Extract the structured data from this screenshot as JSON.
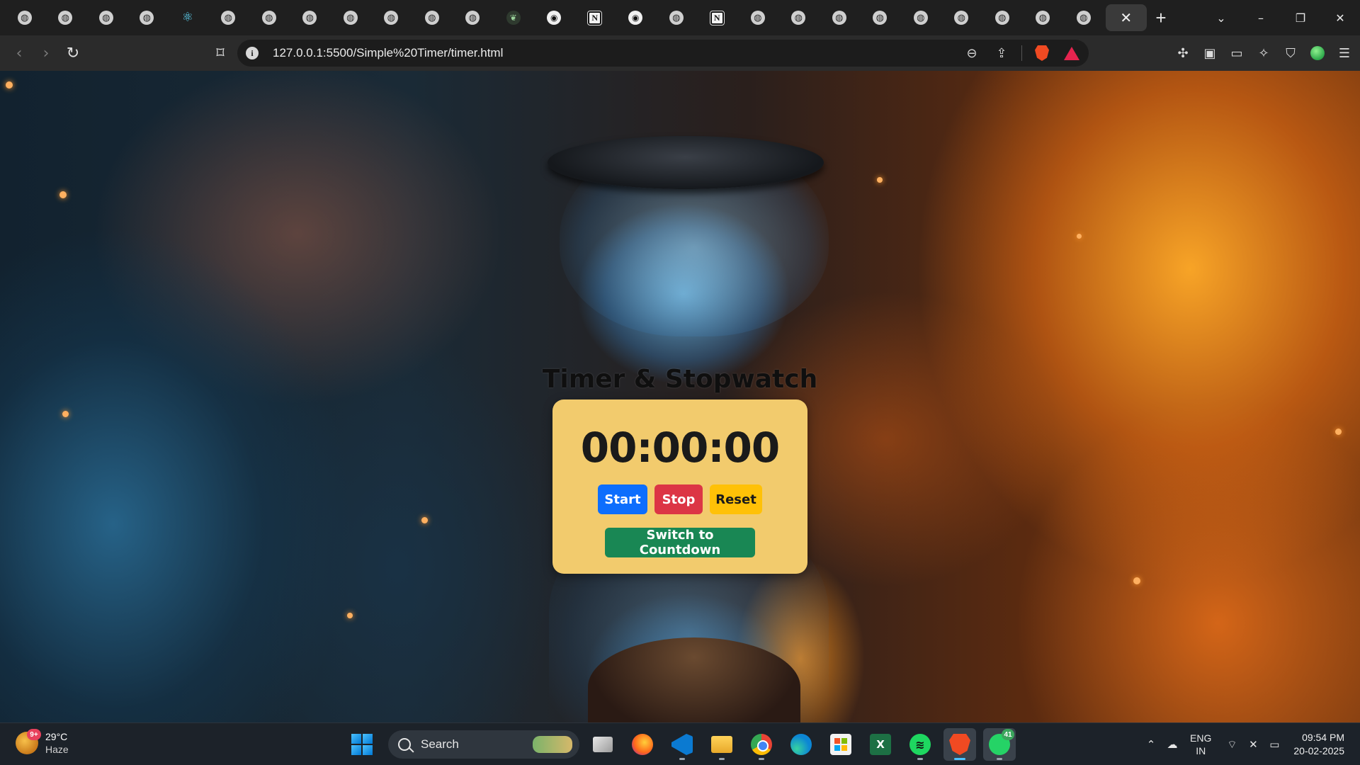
{
  "browser": {
    "tabs": [
      {
        "icon": "globe-icon"
      },
      {
        "icon": "globe-icon"
      },
      {
        "icon": "globe-icon"
      },
      {
        "icon": "globe-icon"
      },
      {
        "icon": "react-icon"
      },
      {
        "icon": "globe-icon"
      },
      {
        "icon": "globe-icon"
      },
      {
        "icon": "globe-icon"
      },
      {
        "icon": "globe-icon"
      },
      {
        "icon": "globe-icon"
      },
      {
        "icon": "globe-icon"
      },
      {
        "icon": "globe-icon"
      },
      {
        "icon": "leaf-icon"
      },
      {
        "icon": "github-icon"
      },
      {
        "icon": "notion-icon"
      },
      {
        "icon": "github-icon"
      },
      {
        "icon": "globe-icon"
      },
      {
        "icon": "notion-icon"
      },
      {
        "icon": "globe-icon"
      },
      {
        "icon": "globe-icon"
      },
      {
        "icon": "globe-icon"
      },
      {
        "icon": "globe-icon"
      },
      {
        "icon": "globe-icon"
      },
      {
        "icon": "globe-icon"
      },
      {
        "icon": "globe-icon"
      },
      {
        "icon": "globe-icon"
      },
      {
        "icon": "globe-icon"
      }
    ],
    "active_tab_close": "✕",
    "new_tab": "+",
    "url": "127.0.0.1:5500/Simple%20Timer/timer.html"
  },
  "app": {
    "title": "Timer & Stopwatch",
    "display": "00:00:00",
    "buttons": {
      "start": "Start",
      "stop": "Stop",
      "reset": "Reset",
      "switch": "Switch to Countdown"
    },
    "colors": {
      "card": "#f2cb6d",
      "start": "#0d6efd",
      "stop": "#dc3545",
      "reset": "#ffc107",
      "switch": "#198754"
    }
  },
  "taskbar": {
    "weather": {
      "temp": "29°C",
      "condition": "Haze",
      "badge": "9+"
    },
    "search_label": "Search",
    "apps": [
      {
        "name": "task-view"
      },
      {
        "name": "firefox"
      },
      {
        "name": "vscode"
      },
      {
        "name": "file-explorer"
      },
      {
        "name": "chrome"
      },
      {
        "name": "edge"
      },
      {
        "name": "microsoft-store"
      },
      {
        "name": "excel"
      },
      {
        "name": "spotify"
      },
      {
        "name": "brave"
      },
      {
        "name": "whatsapp"
      }
    ],
    "whatsapp_badge": "41",
    "lang": {
      "line1": "ENG",
      "line2": "IN"
    },
    "clock": {
      "time": "09:54 PM",
      "date": "20-02-2025"
    }
  }
}
